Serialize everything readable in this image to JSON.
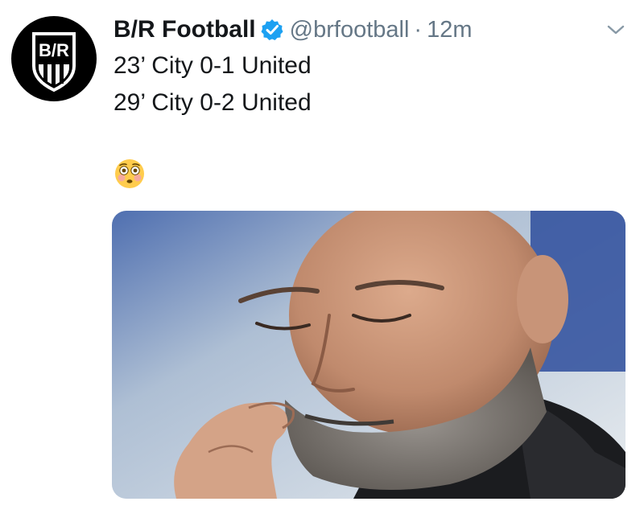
{
  "tweet": {
    "author": {
      "name": "B/R Football",
      "handle": "@brfootball",
      "verified": true,
      "avatar_icon": "br-shield-logo",
      "avatar_text": "B/R"
    },
    "separator": "·",
    "timestamp": "12m",
    "lines": [
      "23’ City 0-1 United",
      "29’ City 0-2 United"
    ],
    "emoji": "flushed-face",
    "media": {
      "kind": "photo",
      "subject": "man with eyes closed, hand at collar"
    },
    "menu_icon": "chevron-down-icon"
  },
  "colors": {
    "text": "#14171a",
    "secondary": "#657786",
    "verified_blue": "#1da1f2",
    "avatar_bg": "#000000"
  }
}
